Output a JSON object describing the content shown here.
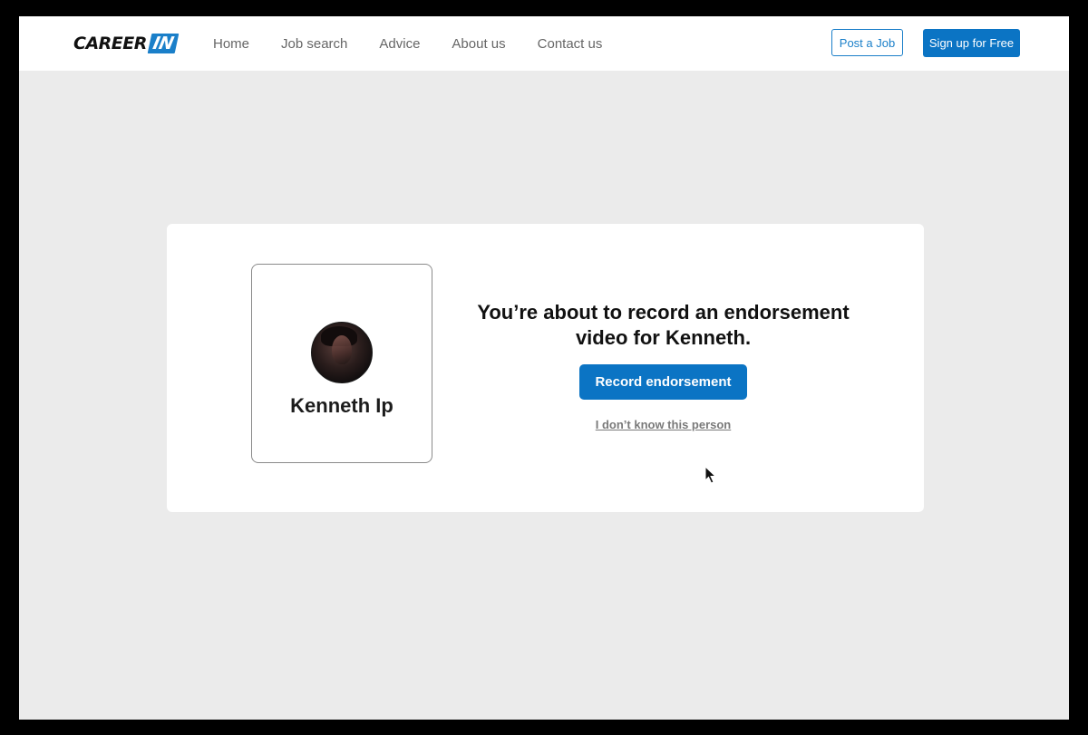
{
  "header": {
    "logo_text": "CAREER",
    "logo_badge": "IN",
    "nav": [
      {
        "label": "Home"
      },
      {
        "label": "Job search"
      },
      {
        "label": "Advice"
      },
      {
        "label": "About us"
      },
      {
        "label": "Contact us"
      }
    ],
    "post_job_label": "Post a Job",
    "signup_label": "Sign up for Free"
  },
  "card": {
    "profile_name": "Kenneth Ip",
    "headline": "You’re about to record an endorsement video for Kenneth.",
    "record_button_label": "Record endorsement",
    "unknown_link_label": "I don’t know this person"
  },
  "colors": {
    "brand_blue": "#0b74c4",
    "background": "#ebebeb"
  },
  "icons": {
    "cursor": "mouse-pointer-icon"
  }
}
